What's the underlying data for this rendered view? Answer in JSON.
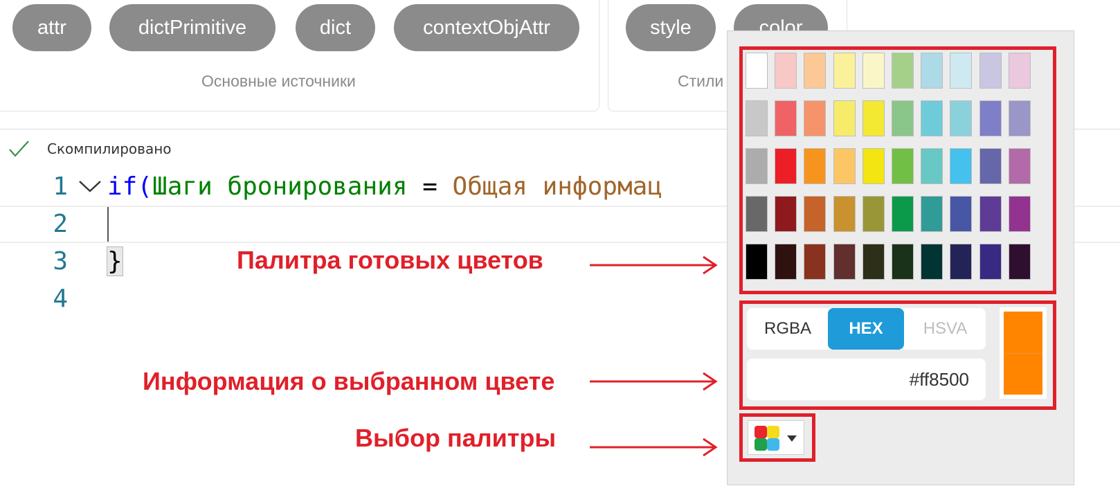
{
  "top_panel": {
    "groups": [
      {
        "caption": "Основные источники",
        "chips": [
          "attr",
          "dictPrimitive",
          "dict",
          "contextObjAttr"
        ]
      },
      {
        "caption": "Стили",
        "chips": [
          "style",
          "color"
        ]
      }
    ]
  },
  "status_bar": {
    "text": "Скомпилировано",
    "icon": "check-icon"
  },
  "editor": {
    "line_numbers": [
      "1",
      "2",
      "3",
      "4"
    ],
    "line1": {
      "keyword": "if",
      "open_paren": "(",
      "field": "Шаги бронирования",
      "operator": " = ",
      "value": "Общая информац"
    },
    "line3": {
      "brace": "}"
    }
  },
  "annotations": {
    "palette": "Палитра готовых цветов",
    "info": "Информация о выбранном цвете",
    "select": "Выбор палитры"
  },
  "color_picker": {
    "swatches": [
      [
        "#ffffff",
        "#f8c8c6",
        "#fcc896",
        "#faf19a",
        "#fbf6c8",
        "#a5d08a",
        "#acdae6",
        "#cfe9f1",
        "#c9c6e2",
        "#eac8de"
      ],
      [
        "#c8c8c8",
        "#ef6366",
        "#f5946a",
        "#f6ec6a",
        "#f3e933",
        "#8ac68a",
        "#6ecbd9",
        "#8bd1dc",
        "#7f7fc7",
        "#9a96c8"
      ],
      [
        "#acacac",
        "#ec1f26",
        "#f7941d",
        "#fcc665",
        "#f2e511",
        "#72bf45",
        "#67c8c5",
        "#44c1ed",
        "#6567aa",
        "#b36aa9"
      ],
      [
        "#686868",
        "#8f1a1d",
        "#c5632b",
        "#c9922f",
        "#999638",
        "#0b9a49",
        "#319b98",
        "#4856a6",
        "#5e3c96",
        "#923390"
      ],
      [
        "#000000",
        "#2f1210",
        "#8a3220",
        "#612f2e",
        "#2e2f18",
        "#193219",
        "#033434",
        "#242358",
        "#382a83",
        "#2f0f30"
      ]
    ],
    "formats": [
      "RGBA",
      "HEX",
      "HSVA"
    ],
    "active_format": "HEX",
    "hex_value": "#ff8500",
    "selected_color": "#ff8500",
    "accent_color": "#1e9bd8",
    "frame_color": "#e0202a"
  }
}
